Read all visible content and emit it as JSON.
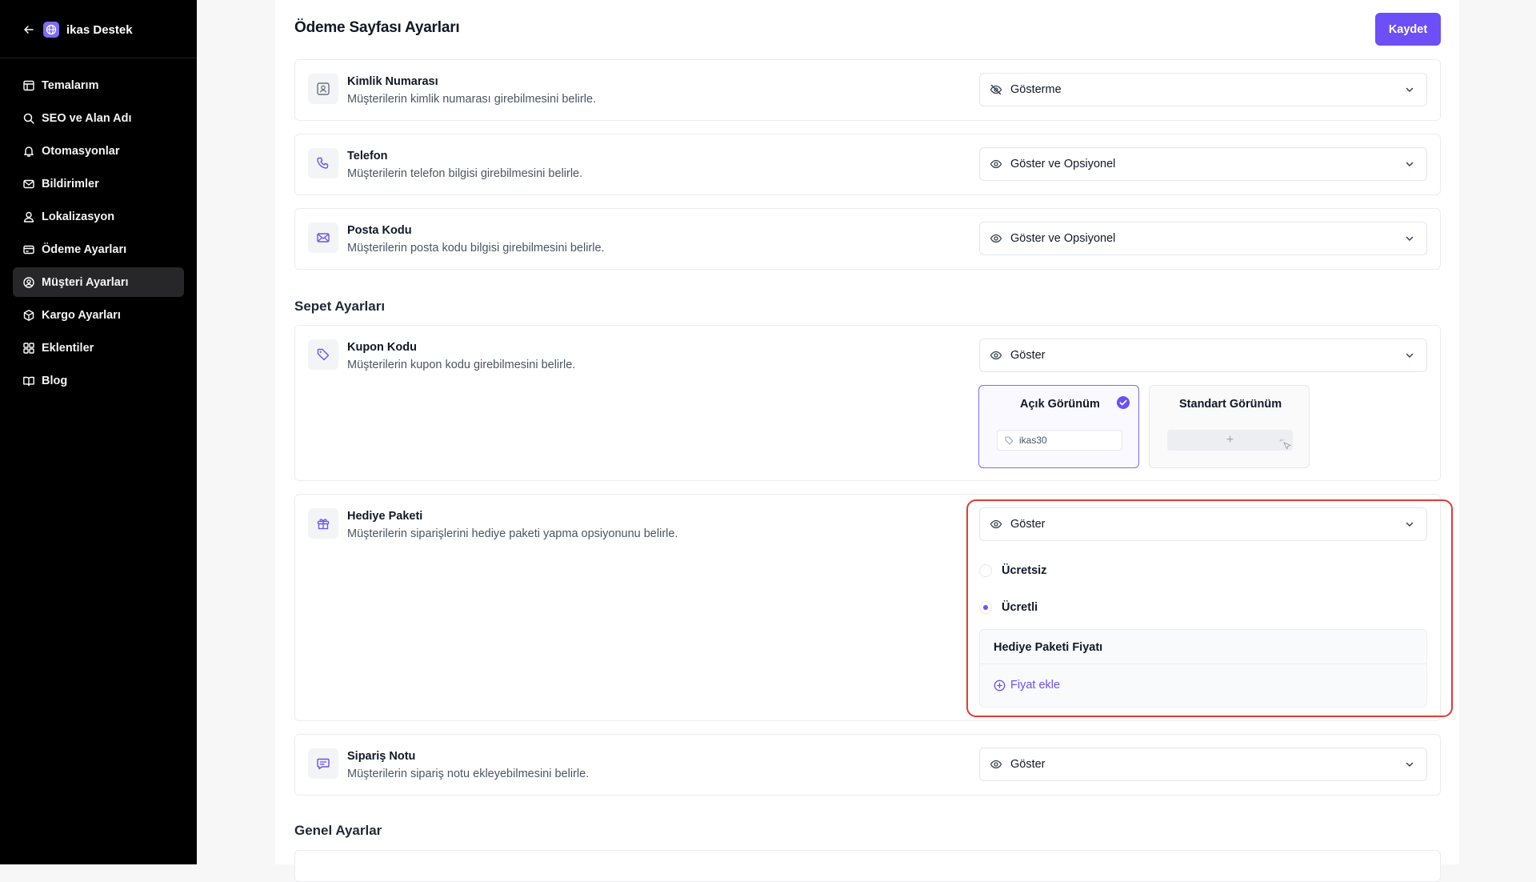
{
  "sidebar": {
    "brand": "ikas Destek",
    "items": [
      {
        "label": "Temalarım",
        "icon": "layout-icon"
      },
      {
        "label": "SEO ve Alan Adı",
        "icon": "search-icon"
      },
      {
        "label": "Otomasyonlar",
        "icon": "bell-icon"
      },
      {
        "label": "Bildirimler",
        "icon": "mail-icon"
      },
      {
        "label": "Lokalizasyon",
        "icon": "globe-user-icon"
      },
      {
        "label": "Ödeme Ayarları",
        "icon": "credit-card-icon"
      },
      {
        "label": "Müşteri Ayarları",
        "icon": "user-circle-icon",
        "active": true
      },
      {
        "label": "Kargo Ayarları",
        "icon": "box-icon"
      },
      {
        "label": "Eklentiler",
        "icon": "grid-icon"
      },
      {
        "label": "Blog",
        "icon": "book-icon"
      }
    ]
  },
  "header": {
    "title": "Ödeme Sayfası Ayarları",
    "save_label": "Kaydet"
  },
  "rows": {
    "kimlik": {
      "title": "Kimlik Numarası",
      "desc": "Müşterilerin kimlik numarası girebilmesini belirle.",
      "value": "Gösterme"
    },
    "telefon": {
      "title": "Telefon",
      "desc": "Müşterilerin telefon bilgisi girebilmesini belirle.",
      "value": "Göster ve Opsiyonel"
    },
    "posta": {
      "title": "Posta Kodu",
      "desc": "Müşterilerin posta kodu bilgisi girebilmesini belirle.",
      "value": "Göster ve Opsiyonel"
    },
    "kupon": {
      "title": "Kupon Kodu",
      "desc": "Müşterilerin kupon kodu girebilmesini belirle.",
      "value": "Göster"
    },
    "hediye": {
      "title": "Hediye Paketi",
      "desc": "Müşterilerin siparişlerini hediye paketi yapma opsiyonunu belirle.",
      "value": "Göster"
    },
    "siparis": {
      "title": "Sipariş Notu",
      "desc": "Müşterilerin sipariş notu ekleyebilmesini belirle.",
      "value": "Göster"
    }
  },
  "sections": {
    "sepet": "Sepet Ayarları",
    "genel": "Genel Ayarlar"
  },
  "coupon_views": {
    "open": {
      "label": "Açık Görünüm",
      "sample": "ikas30",
      "selected": true
    },
    "standard": {
      "label": "Standart Görünüm",
      "plus": "+"
    }
  },
  "gift": {
    "options": [
      {
        "label": "Ücretsiz",
        "selected": false
      },
      {
        "label": "Ücretli",
        "selected": true
      }
    ],
    "price_title": "Hediye Paketi Fiyatı",
    "add_price": "Fiyat ekle"
  },
  "colors": {
    "accent": "#6c4ff7",
    "highlight": "#e53935",
    "sidebar_bg": "#000000"
  }
}
